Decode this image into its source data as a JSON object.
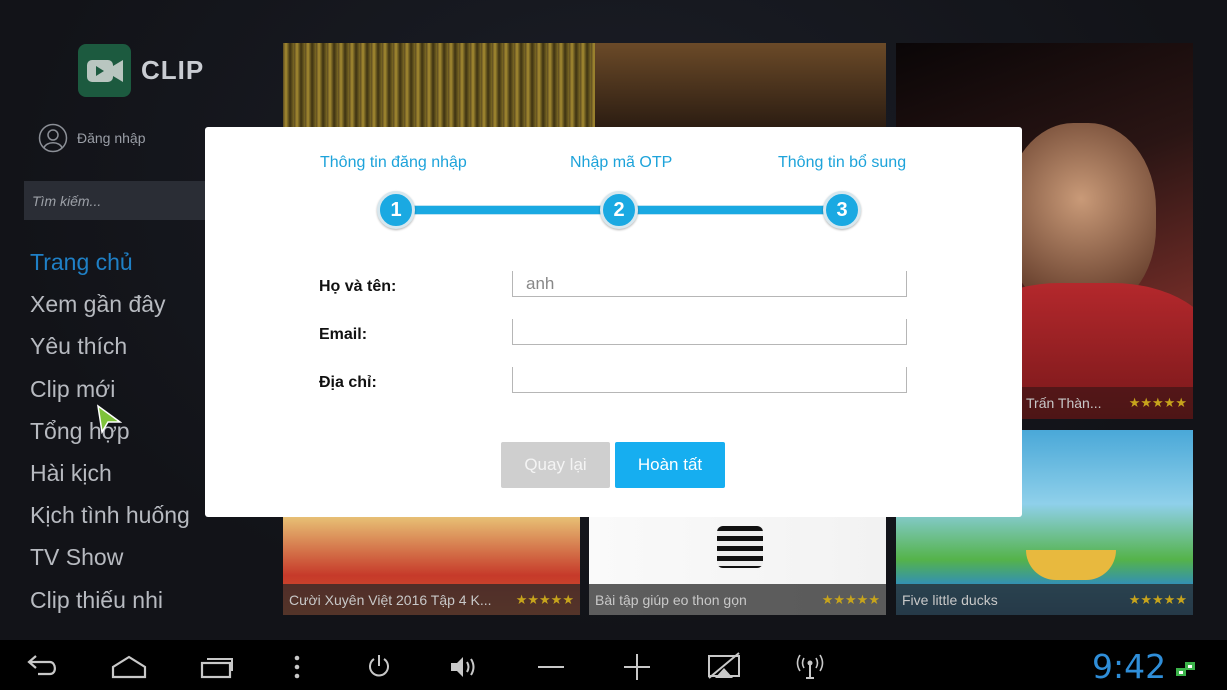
{
  "app": {
    "logo_text": "CLIP",
    "login_label": "Đăng nhập",
    "search_placeholder": "Tìm kiếm..."
  },
  "menu": {
    "items": [
      {
        "label": "Trang chủ",
        "active": true
      },
      {
        "label": "Xem gần đây"
      },
      {
        "label": "Yêu thích"
      },
      {
        "label": "Clip mới"
      },
      {
        "label": "Tổng hợp"
      },
      {
        "label": "Hài kịch"
      },
      {
        "label": "Kịch tình huống"
      },
      {
        "label": "TV Show"
      },
      {
        "label": "Clip thiếu nhi"
      }
    ]
  },
  "thumbnails": [
    {
      "title": "",
      "stars": ""
    },
    {
      "title": "Trấn Thàn...",
      "stars": "★★★★★"
    },
    {
      "title": "Cười Xuyên Việt 2016 Tập 4 K...",
      "stars": "★★★★★"
    },
    {
      "title": "Bài tập giúp eo thon gọn",
      "stars": "★★★★★"
    },
    {
      "title": "Five little ducks",
      "stars": "★★★★★"
    }
  ],
  "dialog": {
    "steps": [
      {
        "label": "Thông tin đăng nhập",
        "number": "1"
      },
      {
        "label": "Nhập mã OTP",
        "number": "2"
      },
      {
        "label": "Thông tin bổ sung",
        "number": "3"
      }
    ],
    "fields": [
      {
        "label": "Họ và tên:",
        "value": "anh"
      },
      {
        "label": "Email:",
        "value": ""
      },
      {
        "label": "Địa chỉ:",
        "value": ""
      }
    ],
    "back_label": "Quay lại",
    "done_label": "Hoàn tất"
  },
  "system_bar": {
    "time": "9:42",
    "accent": "#2f8ed9"
  },
  "colors": {
    "accent": "#1aa9e2",
    "menu_active": "#1f80c6",
    "star": "#c7a41c"
  }
}
